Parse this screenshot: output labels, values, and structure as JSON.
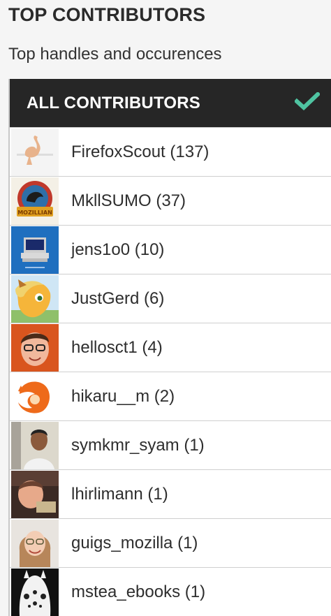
{
  "page": {
    "title": "TOP CONTRIBUTORS",
    "subtitle": "Top handles and occurences"
  },
  "filter": {
    "label": "ALL CONTRIBUTORS",
    "selected_icon": "checkmark-icon",
    "check_color": "#4fc3a1"
  },
  "contributors": [
    {
      "label": "FirefoxScout (137)",
      "avatar": "firefox-scout-avatar"
    },
    {
      "label": "MkllSUMO (37)",
      "avatar": "mozillian-badge-avatar"
    },
    {
      "label": "jens1o0 (10)",
      "avatar": "retro-computer-avatar"
    },
    {
      "label": "JustGerd (6)",
      "avatar": "pony-avatar"
    },
    {
      "label": "hellosct1 (4)",
      "avatar": "person-photo-avatar"
    },
    {
      "label": "hikaru__m (2)",
      "avatar": "firefox-logo-avatar"
    },
    {
      "label": "symkmr_syam (1)",
      "avatar": "person-photo-avatar"
    },
    {
      "label": "lhirlimann (1)",
      "avatar": "child-photo-avatar"
    },
    {
      "label": "guigs_mozilla (1)",
      "avatar": "person-photo-avatar"
    },
    {
      "label": "mstea_ebooks (1)",
      "avatar": "creature-avatar"
    }
  ]
}
